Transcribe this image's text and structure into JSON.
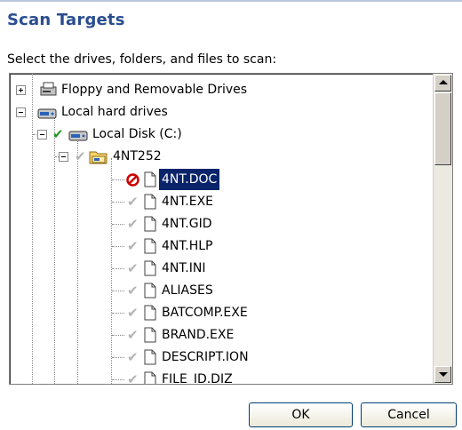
{
  "dialog": {
    "title": "Scan Targets",
    "instruction": "Select the drives, folders, and files to scan:"
  },
  "tree": {
    "items": [
      {
        "label": "Floppy and Removable Drives",
        "icon": "removable-drive-icon",
        "expander": "plus",
        "check": "none"
      },
      {
        "label": "Local hard drives",
        "icon": "hard-drives-icon",
        "expander": "minus",
        "check": "none"
      },
      {
        "label": "Local Disk (C:)",
        "icon": "hard-disk-icon",
        "expander": "minus",
        "check": "checked"
      },
      {
        "label": "4NT252",
        "icon": "folder-icon",
        "expander": "minus",
        "check": "inherited"
      },
      {
        "label": "4NT.DOC",
        "icon": "document-icon",
        "check": "excluded",
        "selected": true
      },
      {
        "label": "4NT.EXE",
        "icon": "document-icon",
        "check": "inherited"
      },
      {
        "label": "4NT.GID",
        "icon": "document-icon",
        "check": "inherited"
      },
      {
        "label": "4NT.HLP",
        "icon": "document-icon",
        "check": "inherited"
      },
      {
        "label": "4NT.INI",
        "icon": "document-icon",
        "check": "inherited"
      },
      {
        "label": "ALIASES",
        "icon": "document-icon",
        "check": "inherited"
      },
      {
        "label": "BATCOMP.EXE",
        "icon": "document-icon",
        "check": "inherited"
      },
      {
        "label": "BRAND.EXE",
        "icon": "document-icon",
        "check": "inherited"
      },
      {
        "label": "DESCRIPT.ION",
        "icon": "document-icon",
        "check": "inherited"
      },
      {
        "label": "FILE_ID.DIZ",
        "icon": "document-icon",
        "check": "inherited"
      }
    ]
  },
  "buttons": {
    "ok": "OK",
    "cancel": "Cancel"
  },
  "colors": {
    "title": "#2a4d8f",
    "selection": "#0a246a",
    "check": "#1e9a1e",
    "excluded": "#cc0000"
  }
}
